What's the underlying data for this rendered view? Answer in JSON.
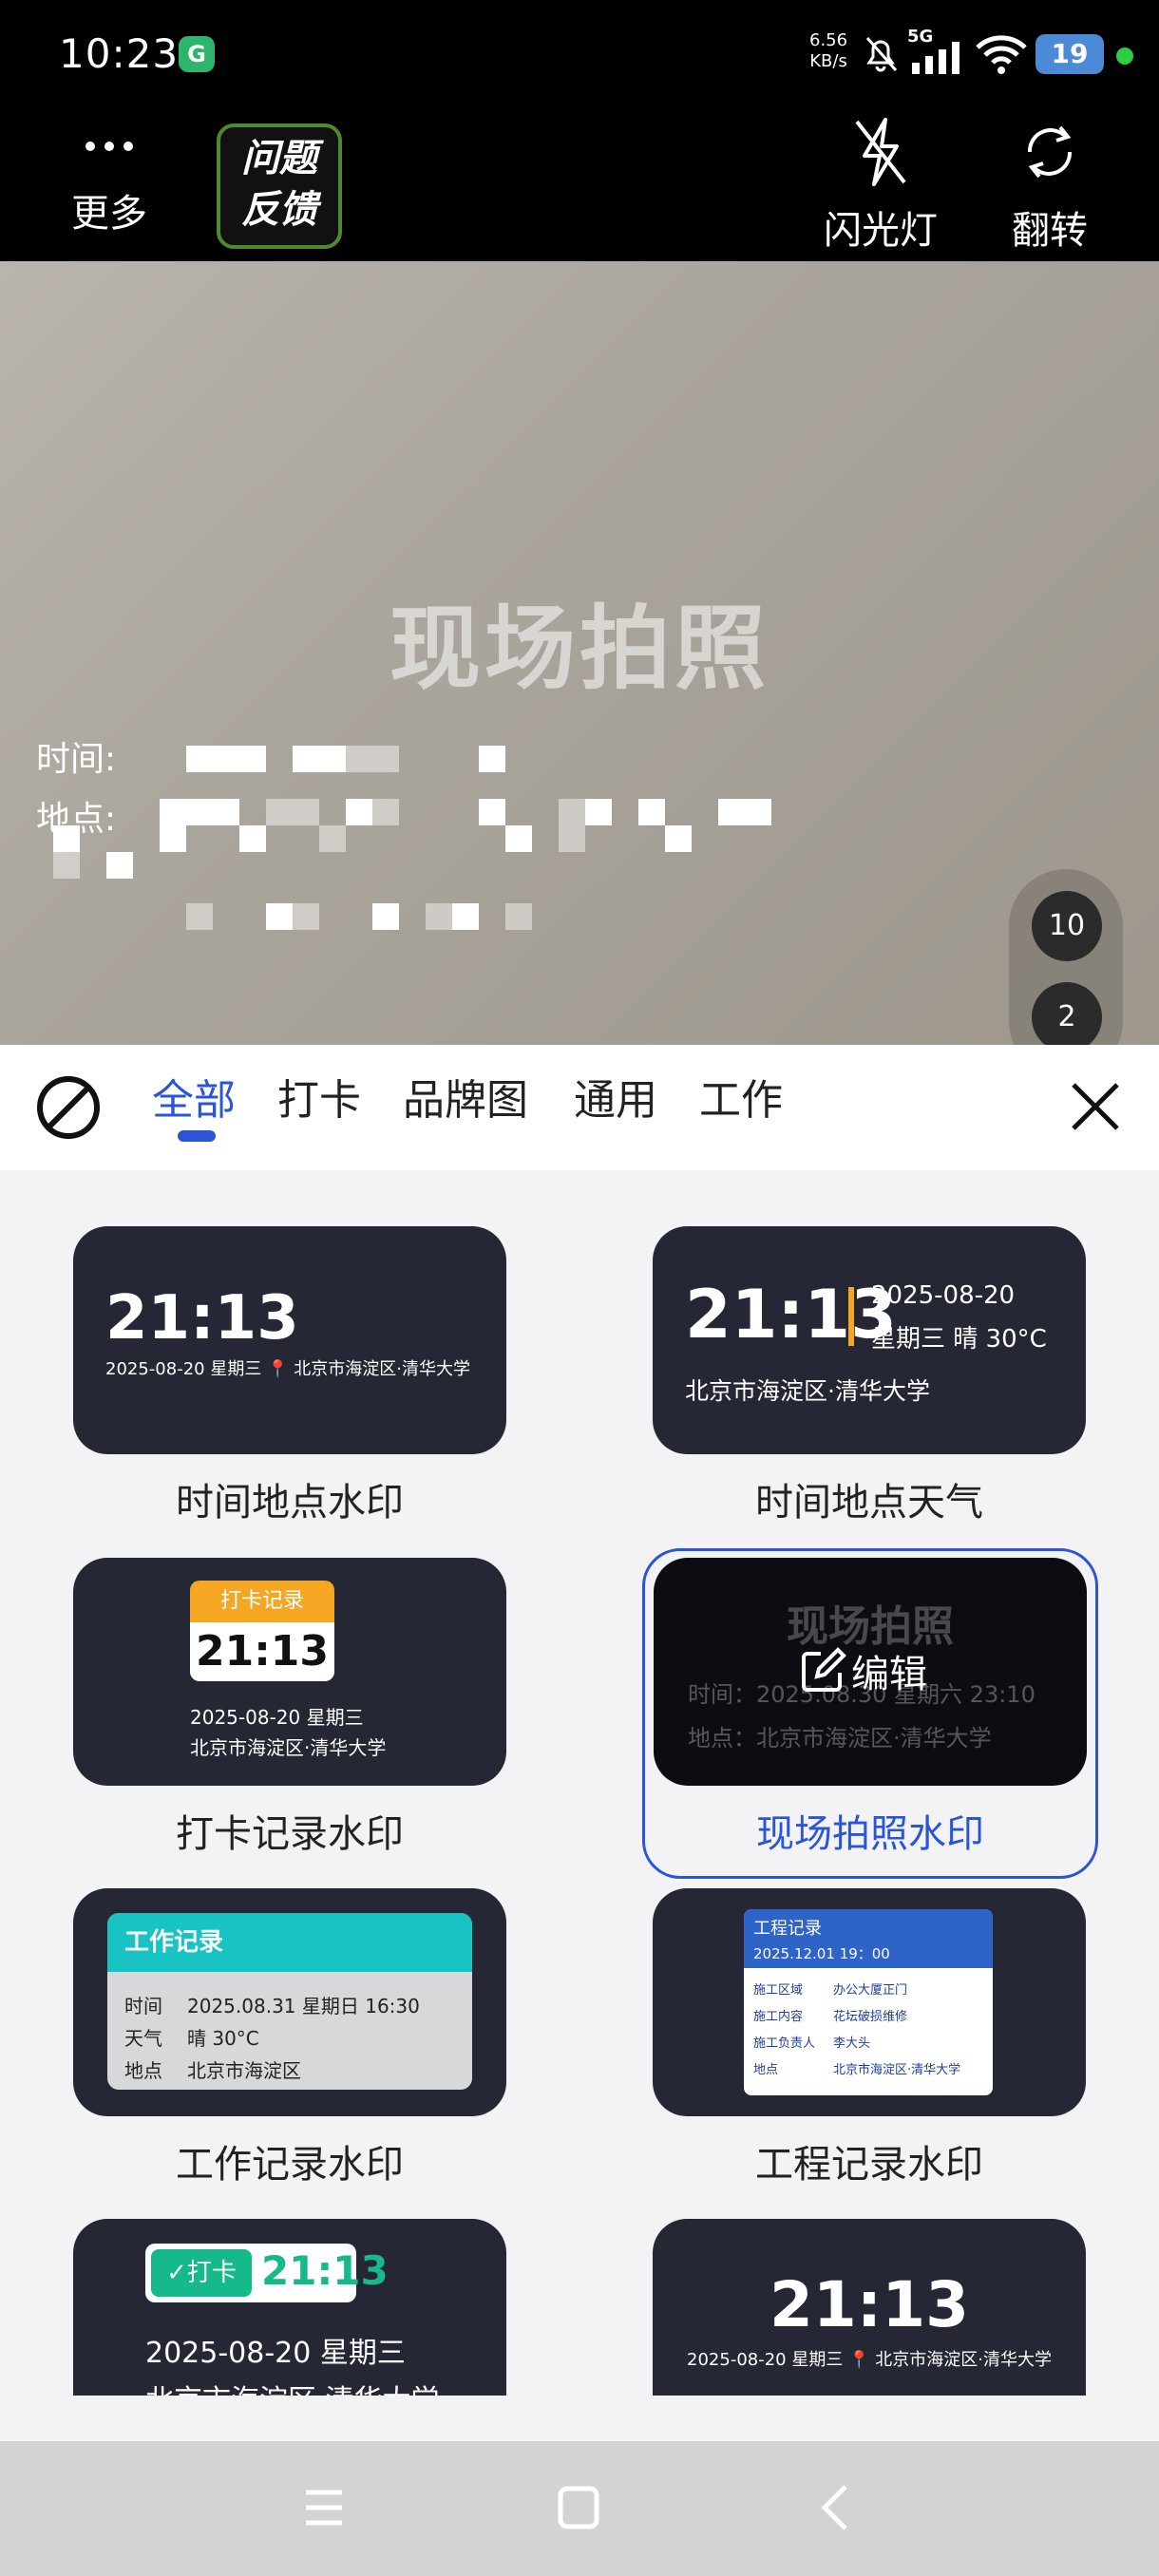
{
  "status_bar": {
    "time": "10:23",
    "app_badge": "G",
    "net_speed_value": "6.56",
    "net_speed_unit": "KB/s",
    "signal_label": "5G",
    "battery": "19"
  },
  "toolbar": {
    "more_label": "更多",
    "feedback_line1": "问题",
    "feedback_line2": "反馈",
    "flash_label": "闪光灯",
    "flip_label": "翻转"
  },
  "preview": {
    "watermark_title": "现场拍照",
    "time_label": "时间:",
    "place_label": "地点:",
    "badge_top": "10",
    "badge_bottom": "2"
  },
  "tabs": {
    "items": [
      "全部",
      "打卡",
      "品牌图",
      "通用",
      "工作"
    ],
    "active_index": 0
  },
  "templates": {
    "t1": {
      "name": "时间地点水印",
      "time": "21:13",
      "line": "2025-08-20 星期三",
      "place": "北京市海淀区·清华大学"
    },
    "t2": {
      "name": "时间地点天气",
      "time": "21:13",
      "date": "2025-08-20",
      "weather": "星期三 晴 30°C",
      "place": "北京市海淀区·清华大学"
    },
    "t3": {
      "name": "打卡记录水印",
      "header": "打卡记录",
      "time": "21:13",
      "date": "2025-08-20 星期三",
      "place": "北京市海淀区·清华大学"
    },
    "t4": {
      "name": "现场拍照水印",
      "title": "现场拍照",
      "time_line": "时间：2025.08.30 星期六 23:10",
      "place_line": "地点：北京市海淀区·清华大学",
      "edit_label": "编辑"
    },
    "t5": {
      "name": "工作记录水印",
      "header": "工作记录",
      "rows": [
        {
          "k": "时间",
          "v": "2025.08.31 星期日 16:30"
        },
        {
          "k": "天气",
          "v": "晴 30°C"
        },
        {
          "k": "地点",
          "v": "北京市海淀区"
        }
      ]
    },
    "t6": {
      "name": "工程记录水印",
      "header": "工程记录",
      "datetime": "2025.12.01 19：00",
      "rows": [
        {
          "k": "施工区域",
          "v": "办公大厦正门"
        },
        {
          "k": "施工内容",
          "v": "花坛破损维修"
        },
        {
          "k": "施工负责人",
          "v": "李大头"
        },
        {
          "k": "地点",
          "v": "北京市海淀区·清华大学"
        }
      ]
    },
    "t7": {
      "check_label": "打卡",
      "time": "21:13",
      "date": "2025-08-20 星期三",
      "place": "北京市海淀区·清华大学"
    },
    "t8": {
      "time": "21:13",
      "line": "2025-08-20 星期三",
      "place": "北京市海淀区·清华大学"
    }
  },
  "colors": {
    "accent": "#2a56d6",
    "card_bg": "#252734",
    "orange": "#f5a623",
    "teal": "#17c3c3",
    "green": "#15b98a"
  }
}
